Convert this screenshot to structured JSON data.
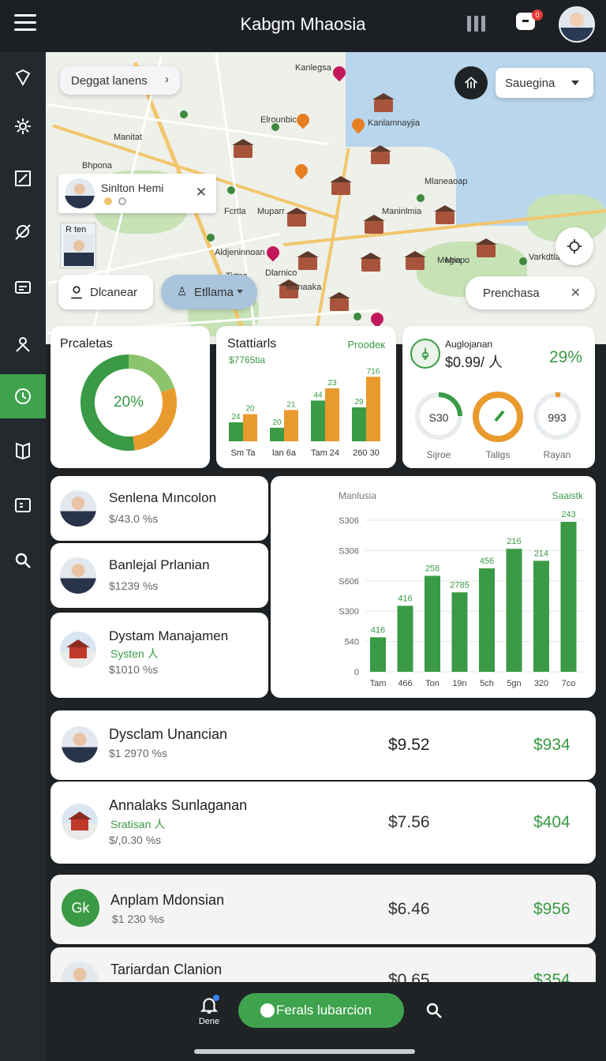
{
  "header": {
    "title": "Kabgm Mhaosia",
    "notification_count": "0"
  },
  "sidebar": {
    "items": [
      {
        "icon": "pin-icon"
      },
      {
        "icon": "gear-icon"
      },
      {
        "icon": "edit-icon"
      },
      {
        "icon": "no-location-icon"
      },
      {
        "icon": "card-icon"
      },
      {
        "icon": "person-icon"
      },
      {
        "icon": "clock-icon",
        "active": true
      },
      {
        "icon": "book-icon"
      },
      {
        "icon": "panel-icon"
      },
      {
        "icon": "search-icon"
      }
    ]
  },
  "map": {
    "breadcrumb": "Deggat lanens",
    "select_value": "Sauegina",
    "labels": [
      "Kanlegsa",
      "Manitat",
      "Bhpona",
      "Elrounbic",
      "Kanlamnayjia",
      "Muparr",
      "Fcrtla",
      "Mrepo",
      "Maninlmia",
      "Tirtna",
      "Aldjeninnoan",
      "Dlarnico",
      "Manaaka",
      "Megia",
      "Varkdtla",
      "Mlaneaoap"
    ],
    "profile_popup": {
      "name": "Sinlton Hemi"
    },
    "mini_label": "R ten",
    "buttons": {
      "left": "Dlcanear",
      "middle": "Etllama",
      "right": "Prenchasa"
    }
  },
  "cards": {
    "donut": {
      "title": "Prcaletas",
      "center": "20%"
    },
    "stats": {
      "title": "Stattiarls",
      "tag": "Proodeк",
      "sub": "$7765tia"
    },
    "gauges": {
      "title": "Auglojanan",
      "value": "$0.99/ 人",
      "percent": "29%",
      "items": [
        {
          "value": "S30",
          "label": "Sijroe"
        },
        {
          "value": "",
          "label": "Taligs"
        },
        {
          "value": "993",
          "label": "Rayan"
        }
      ]
    }
  },
  "people_list": [
    {
      "name": "Senlena Mıncolon",
      "sub": "",
      "value": "$/43.0 %s"
    },
    {
      "name": "Banlejal Prlanian",
      "sub": "",
      "value": "$1239 %s"
    },
    {
      "name": "Dystam Manajamen",
      "sub": "Systen 人",
      "value": "$1010 %s"
    }
  ],
  "big_chart_text": {
    "title": "Manlusia",
    "tag": "Saaistk"
  },
  "transactions": [
    {
      "name": "Dysclam Unancian",
      "sub": "",
      "value": "$1 2970 %s",
      "price": "$9.52",
      "amount": "$934",
      "avatar": "person"
    },
    {
      "name": "Annalaks Sunlaganan",
      "sub": "Sratisan 人",
      "value": "$/,0.30 %s",
      "price": "$7.56",
      "amount": "$404",
      "avatar": "place"
    },
    {
      "name": "Anplam Mdonsian",
      "sub": "",
      "value": "$1 230 %s",
      "price": "$6.46",
      "amount": "$956",
      "avatar": "initials",
      "initials": "Gk"
    },
    {
      "name": "Tariardan Clanion",
      "sub": "",
      "value": "",
      "price": "$0.65",
      "amount": "$354",
      "avatar": "person"
    }
  ],
  "bottom_nav": {
    "left_label": "Dene",
    "primary_button": "Ferals lubarcion"
  },
  "colors": {
    "green": "#3fa34d",
    "orange": "#e89a2c",
    "dark": "#1f2326"
  },
  "chart_data": [
    {
      "type": "pie",
      "title": "Prcaletas",
      "center_label": "20%",
      "segments": [
        {
          "color": "#8cc46e",
          "value": 20
        },
        {
          "color": "#e89a2c",
          "value": 28
        },
        {
          "color": "#3a9a45",
          "value": 52
        }
      ]
    },
    {
      "type": "bar",
      "title": "Stattiarls",
      "categories": [
        "Sm Ta",
        "lan 6a",
        "Tam 24",
        "260 30"
      ],
      "series": [
        {
          "values": [
            24,
            20,
            44,
            29
          ],
          "color": "#3a9a45",
          "labels": [
            "24",
            "20",
            "44",
            "29"
          ]
        },
        {
          "values": [
            20,
            21,
            23,
            716
          ],
          "color": "#e89a2c",
          "labels": [
            "20",
            "21",
            "23",
            "716"
          ]
        }
      ],
      "relative_heights": [
        [
          0.28,
          0.2,
          0.6,
          0.5
        ],
        [
          0.4,
          0.46,
          0.78,
          0.95
        ]
      ]
    },
    {
      "type": "bar",
      "title": "Manlusia",
      "categories": [
        "Tam",
        "466",
        "Ton",
        "19n",
        "5ch",
        "5gn",
        "320",
        "7co"
      ],
      "values": [
        416,
        416,
        258,
        2785,
        456,
        216,
        214,
        243
      ],
      "labels": [
        "416",
        "416",
        "258",
        "2785",
        "456",
        "216",
        "214",
        "243"
      ],
      "relative_heights": [
        0.23,
        0.44,
        0.64,
        0.53,
        0.69,
        0.82,
        0.74,
        1.0
      ],
      "y_ticks": [
        "S306",
        "S306",
        "S606",
        "S300",
        "540",
        "0"
      ]
    }
  ]
}
